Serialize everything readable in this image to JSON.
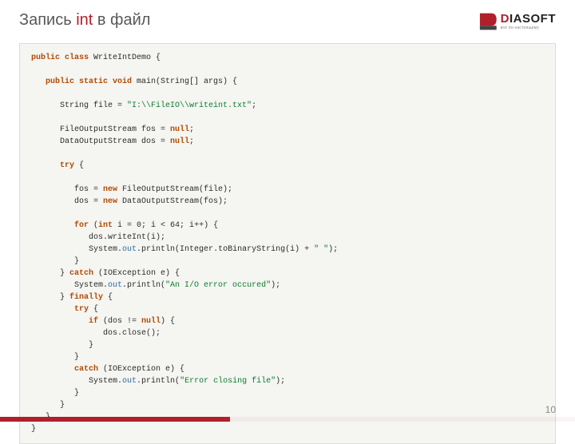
{
  "page": {
    "title_pre": "Запись ",
    "title_kw": "int",
    "title_post": " в файл",
    "page_number": "10"
  },
  "logo": {
    "name": "DIASOFT",
    "tagline": "всё по-настоящему"
  },
  "code": {
    "l01a": "public class ",
    "l01b": "WriteIntDemo {",
    "l02": "",
    "l03a": "   public static void ",
    "l03b": "main(String[] args) {",
    "l04": "",
    "l05a": "      String file = ",
    "l05b": "\"I:\\\\FileIO\\\\writeint.txt\"",
    "l05c": ";",
    "l06": "",
    "l07a": "      FileOutputStream fos = ",
    "l07b": "null",
    "l07c": ";",
    "l08a": "      DataOutputStream dos = ",
    "l08b": "null",
    "l08c": ";",
    "l09": "",
    "l10a": "      try ",
    "l10b": "{",
    "l11": "",
    "l12a": "         fos = ",
    "l12b": "new ",
    "l12c": "FileOutputStream(file);",
    "l13a": "         dos = ",
    "l13b": "new ",
    "l13c": "DataOutputStream(fos);",
    "l14": "",
    "l15a": "         for ",
    "l15b": "(",
    "l15c": "int ",
    "l15d": "i = 0; i < 64; i++) {",
    "l16": "            dos.writeInt(i);",
    "l17a": "            System.",
    "l17b": "out",
    "l17c": ".println(Integer.toBinaryString(i) + ",
    "l17d": "\" \"",
    "l17e": ");",
    "l18": "         }",
    "l19a": "      } ",
    "l19b": "catch ",
    "l19c": "(IOException e) {",
    "l20a": "         System.",
    "l20b": "out",
    "l20c": ".println(",
    "l20d": "\"An I/O error occured\"",
    "l20e": ");",
    "l21a": "      } ",
    "l21b": "finally ",
    "l21c": "{",
    "l22a": "         try ",
    "l22b": "{",
    "l23a": "            if ",
    "l23b": "(dos != ",
    "l23c": "null",
    "l23d": ") {",
    "l24": "               dos.close();",
    "l25": "            }",
    "l26": "         }",
    "l27a": "         catch ",
    "l27b": "(IOException e) {",
    "l28a": "            System.",
    "l28b": "out",
    "l28c": ".println(",
    "l28d": "\"Error closing file\"",
    "l28e": ");",
    "l29": "         }",
    "l30": "      }",
    "l31": "   }",
    "l32": "}"
  }
}
